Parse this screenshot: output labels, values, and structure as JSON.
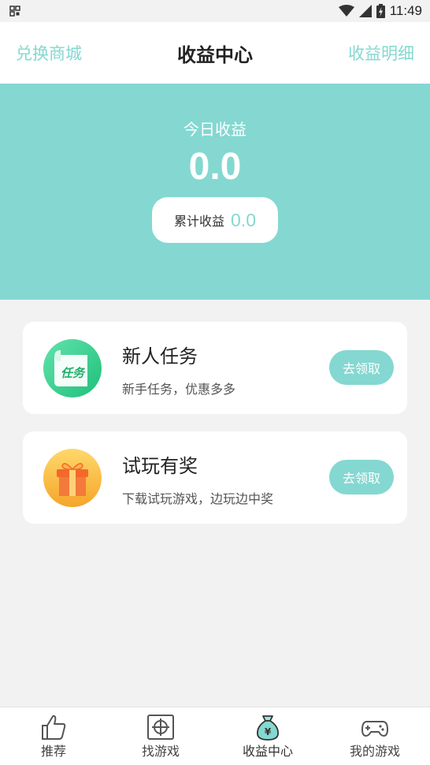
{
  "status_bar": {
    "time": "11:49",
    "left_icon": "qr-grid-icon",
    "icons": [
      "wifi-icon",
      "signal-icon",
      "battery-icon"
    ]
  },
  "header": {
    "left_link": "兑换商城",
    "title": "收益中心",
    "right_link": "收益明细"
  },
  "earnings": {
    "today_label": "今日收益",
    "today_value": "0.0",
    "total_label": "累计收益",
    "total_value": "0.0"
  },
  "tasks": [
    {
      "title": "新人任务",
      "desc": "新手任务，优惠多多",
      "button": "去领取",
      "icon": "task-scroll-icon",
      "icon_text": "任务"
    },
    {
      "title": "试玩有奖",
      "desc": "下载试玩游戏，边玩边中奖",
      "button": "去领取",
      "icon": "gift-box-icon"
    }
  ],
  "bottom_nav": [
    {
      "label": "推荐",
      "icon": "thumbs-up-icon"
    },
    {
      "label": "找游戏",
      "icon": "crosshair-icon"
    },
    {
      "label": "收益中心",
      "icon": "money-bag-icon",
      "active": true
    },
    {
      "label": "我的游戏",
      "icon": "gamepad-icon"
    }
  ],
  "colors": {
    "accent": "#84d8d1",
    "background": "#f2f2f2"
  }
}
